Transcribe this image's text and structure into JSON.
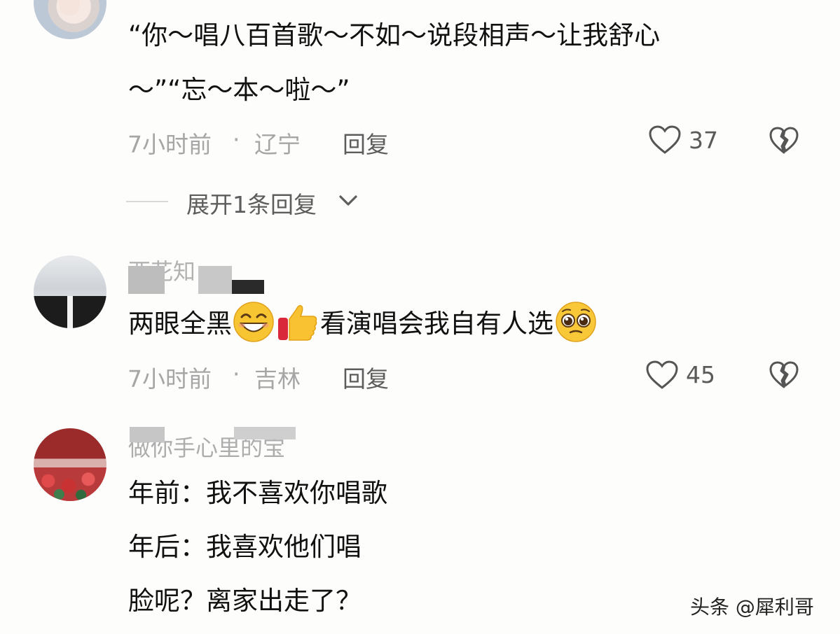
{
  "comments": [
    {
      "text_line1": "“你～唱八百首歌～不如～说段相声～让我舒心",
      "text_line2": "～”“忘～本～啦～”",
      "time": "7小时前",
      "separator": "·",
      "location": "辽宁",
      "reply_label": "回复",
      "likes": "37",
      "expand_label": "展开1条回复"
    },
    {
      "username": "西花知",
      "text_part1": "两眼全黑",
      "text_part2": "看演唱会我自有人选",
      "emojis": [
        "grin-emoji",
        "thumbs-up-emoji",
        "pleading-face-emoji"
      ],
      "time": "7小时前",
      "separator": "·",
      "location": "吉林",
      "reply_label": "回复",
      "likes": "45"
    },
    {
      "username": "做你手心里的宝",
      "line1": "年前：我不喜欢你唱歌",
      "line2": "年后：我喜欢他们唱",
      "line3": "脸呢？离家出走了？"
    }
  ],
  "icons": {
    "like": "heart-outline-icon",
    "dislike": "broken-heart-icon",
    "expand": "chevron-down-icon"
  },
  "watermark": "头条 @犀利哥",
  "colors": {
    "background": "#fdfdfb",
    "meta_text": "#a6a6a6",
    "body_text": "#111111"
  }
}
